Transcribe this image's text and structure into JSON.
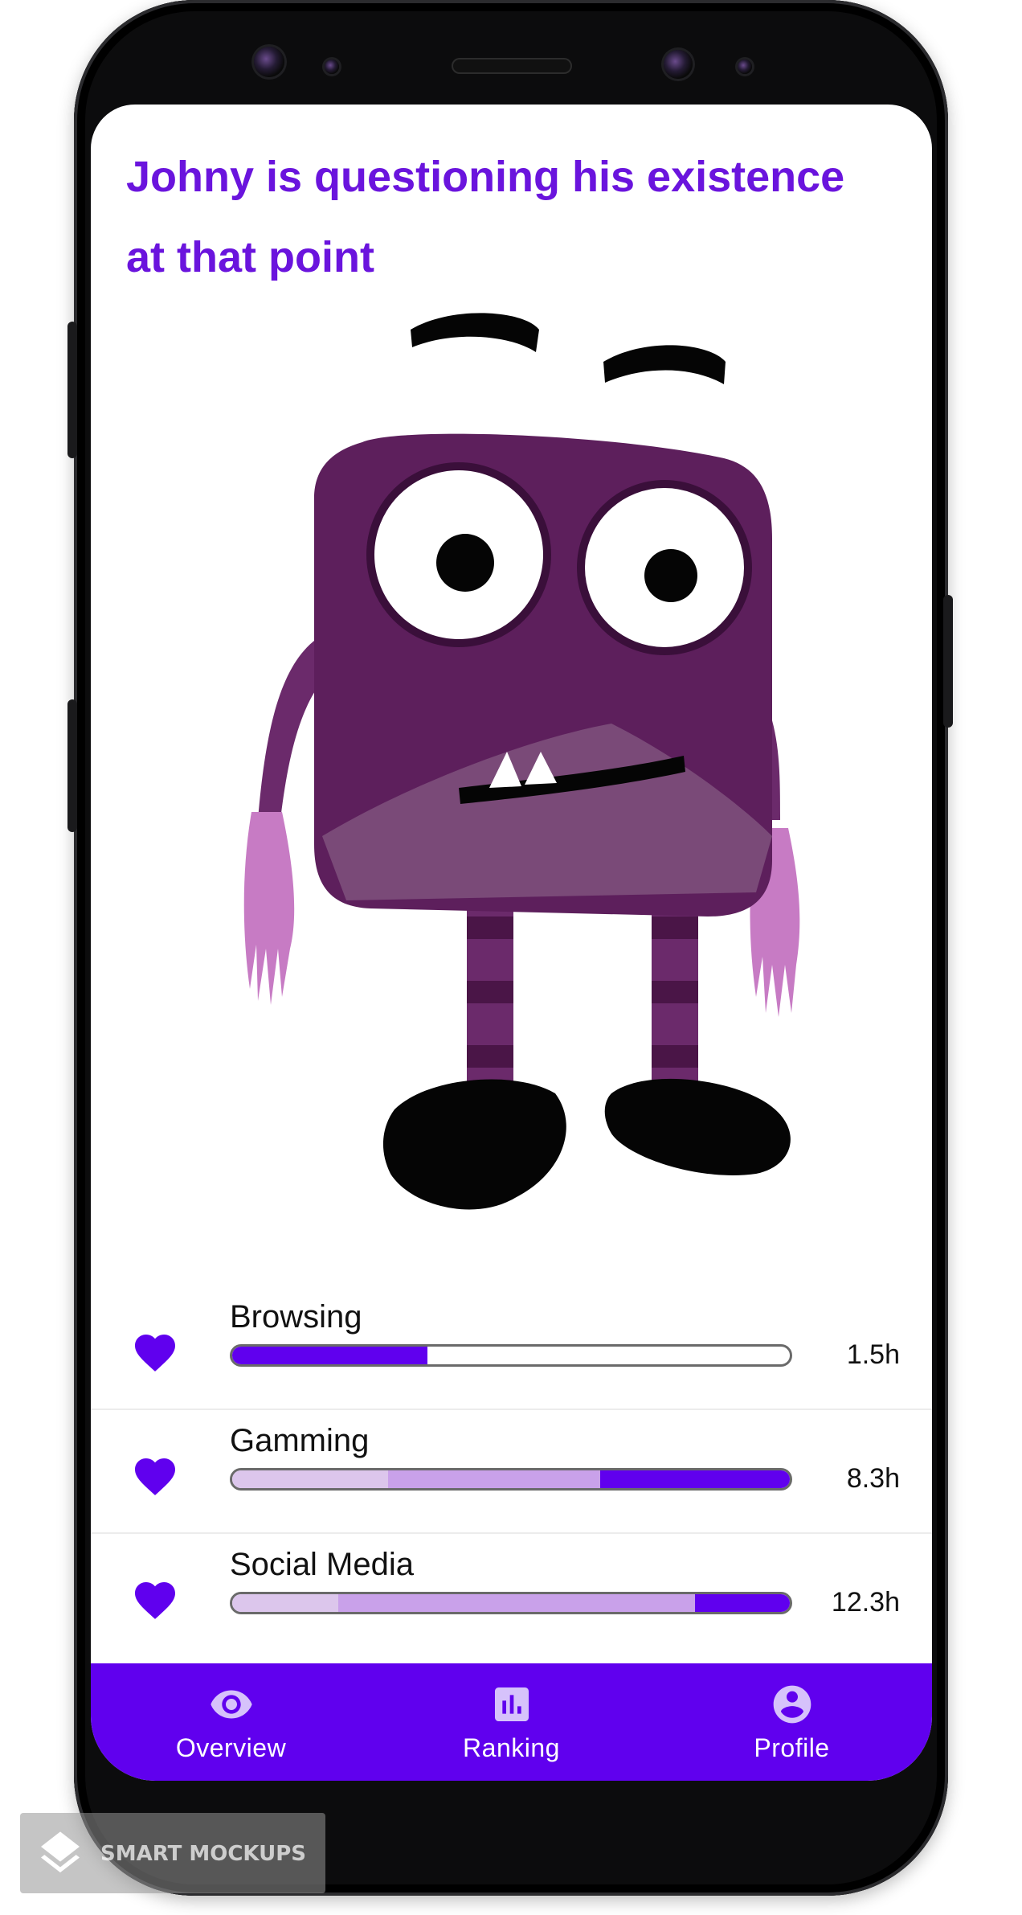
{
  "header": {
    "title": "Johny is questioning his existence at that point"
  },
  "activities": [
    {
      "label": "Browsing",
      "value": "1.5h",
      "progress": 0.35,
      "segments": [
        {
          "start": 0.0,
          "end": 0.35,
          "color": "#6000ee"
        }
      ]
    },
    {
      "label": "Gamming",
      "value": "8.3h",
      "progress": 1.0,
      "segments": [
        {
          "start": 0.0,
          "end": 0.28,
          "color": "#dcc6ec"
        },
        {
          "start": 0.28,
          "end": 0.66,
          "color": "#c9a1ea"
        },
        {
          "start": 0.66,
          "end": 1.0,
          "color": "#6000ee"
        }
      ]
    },
    {
      "label": "Social Media",
      "value": "12.3h",
      "progress": 1.0,
      "segments": [
        {
          "start": 0.0,
          "end": 0.19,
          "color": "#dcc6ec"
        },
        {
          "start": 0.19,
          "end": 0.83,
          "color": "#c9a1ea"
        },
        {
          "start": 0.83,
          "end": 1.0,
          "color": "#6000ee"
        }
      ]
    }
  ],
  "nav": {
    "items": [
      {
        "label": "Overview",
        "icon": "eye-icon"
      },
      {
        "label": "Ranking",
        "icon": "bar-chart-icon"
      },
      {
        "label": "Profile",
        "icon": "account-circle-icon"
      }
    ]
  },
  "watermark": {
    "text": "SMART MOCKUPS"
  },
  "colors": {
    "accent": "#6000ee",
    "title": "#6a14dd",
    "monster_body": "#5d1f5c",
    "monster_hands": "#c77bc4"
  }
}
